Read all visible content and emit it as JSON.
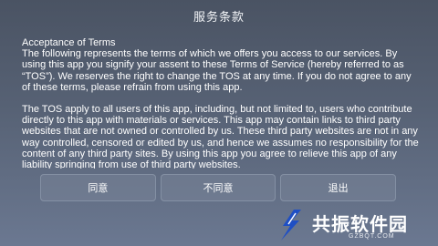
{
  "dialog": {
    "title": "服务条款",
    "heading": "Acceptance of Terms",
    "paragraph1": "The following represents the terms of which we offers you access to our services. By using this app you signify your assent to these Terms of Service (hereby referred to as “TOS”). We reserves the right to change the TOS at any time. If you do not agree to any of these terms, please refrain from using this app.",
    "paragraph2": "The TOS apply to all users of this app, including, but not limited to, users who contribute directly to this app with materials or services. This app may contain links to third party websites that are not owned or controlled by us. These third party websites are not in any way controlled, censored or edited by us, and hence we assumes no responsibility for the content of any third party sites. By using this app you agree to relieve this app of any liability springing from use of third party websites."
  },
  "buttons": {
    "agree": "同意",
    "disagree": "不同意",
    "exit": "退出"
  },
  "watermark": {
    "text": "共振软件园",
    "url": "GZBQT.COM",
    "logo_icon": "gongzhen-logo-icon",
    "color": "#1f4fc4"
  }
}
